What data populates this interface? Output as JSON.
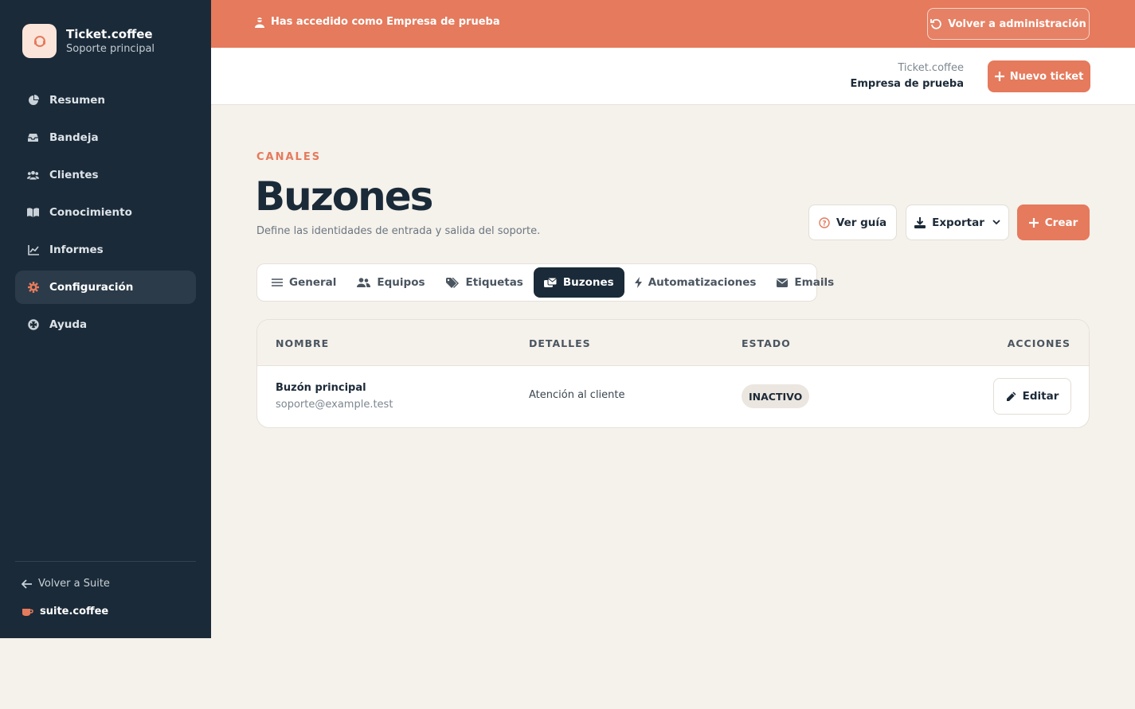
{
  "brand": {
    "name": "Ticket.coffee",
    "subtitle": "Soporte principal"
  },
  "sidebar": {
    "items": [
      {
        "label": "Resumen",
        "icon": "chart-pie-icon",
        "active": false
      },
      {
        "label": "Bandeja",
        "icon": "inbox-icon",
        "active": false
      },
      {
        "label": "Clientes",
        "icon": "users-icon",
        "active": false
      },
      {
        "label": "Conocimiento",
        "icon": "book-icon",
        "active": false
      },
      {
        "label": "Informes",
        "icon": "chart-line-icon",
        "active": false
      },
      {
        "label": "Configuración",
        "icon": "gear-icon",
        "active": true
      },
      {
        "label": "Ayuda",
        "icon": "life-ring-icon",
        "active": false
      }
    ],
    "back_label": "Volver a Suite",
    "suite_name": "suite.coffee"
  },
  "banner": {
    "message": "Has accedido como Empresa de prueba",
    "admin_button": "Volver a administración"
  },
  "header": {
    "app_name": "Ticket.coffee",
    "org_name": "Empresa de prueba",
    "new_ticket": "Nuevo ticket"
  },
  "page": {
    "eyebrow": "CANALES",
    "title": "Buzones",
    "description": "Define las identidades de entrada y salida del soporte.",
    "actions": {
      "guide": "Ver guía",
      "export": "Exportar",
      "create": "Crear"
    }
  },
  "tabs": [
    {
      "label": "General",
      "icon": "sliders-icon",
      "active": false
    },
    {
      "label": "Equipos",
      "icon": "users-icon",
      "active": false
    },
    {
      "label": "Etiquetas",
      "icon": "tags-icon",
      "active": false
    },
    {
      "label": "Buzones",
      "icon": "mailbox-icon",
      "active": true
    },
    {
      "label": "Automatizaciones",
      "icon": "bolt-icon",
      "active": false
    },
    {
      "label": "Emails",
      "icon": "envelope-icon",
      "active": false
    }
  ],
  "table": {
    "columns": [
      "NOMBRE",
      "DETALLES",
      "ESTADO",
      "ACCIONES"
    ],
    "rows": [
      {
        "name": "Buzón principal",
        "email": "soporte@example.test",
        "details": "Atención al cliente",
        "status": "INACTIVO",
        "action": "Editar"
      }
    ]
  },
  "colors": {
    "accent": "#e57a5c",
    "sidebar": "#1a2a38",
    "background": "#f5f1eb"
  }
}
